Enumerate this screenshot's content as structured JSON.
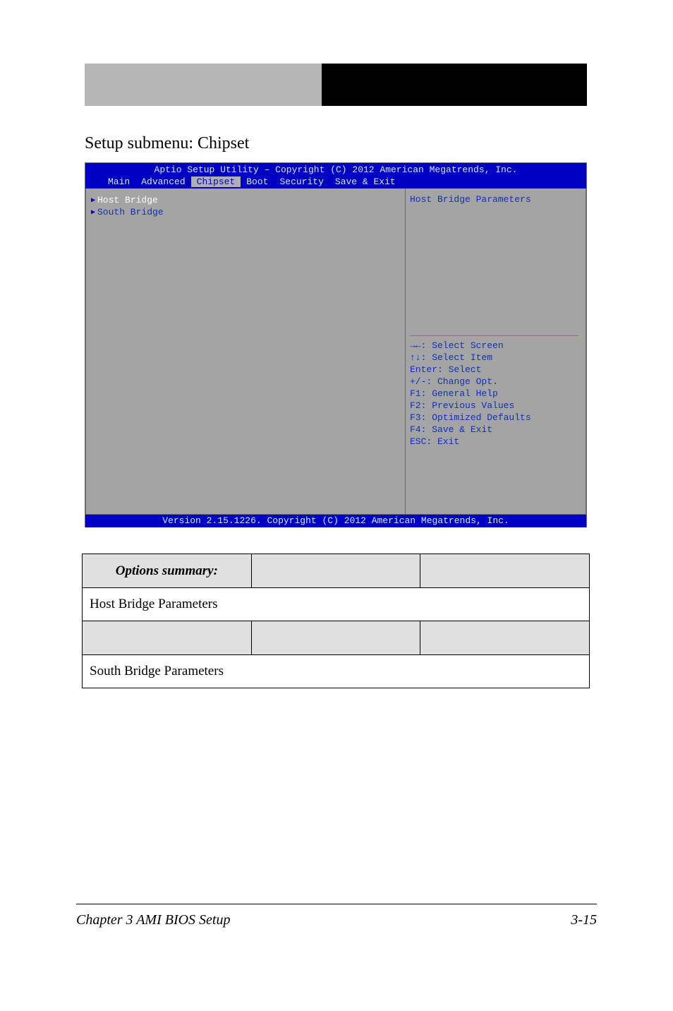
{
  "header": {
    "black_text": ""
  },
  "section_title": "Setup submenu: Chipset",
  "bios": {
    "title": "Aptio Setup Utility – Copyright (C) 2012 American Megatrends, Inc.",
    "menu": {
      "items": [
        "Main",
        "Advanced",
        "Chipset",
        "Boot",
        "Security",
        "Save & Exit"
      ],
      "active_index": 2
    },
    "left_items": [
      {
        "label": "Host Bridge",
        "selected": true
      },
      {
        "label": "South Bridge",
        "selected": false
      }
    ],
    "help_title": "Host Bridge Parameters",
    "keys": [
      "→←: Select Screen",
      "↑↓: Select Item",
      "Enter: Select",
      "+/-: Change Opt.",
      "F1: General Help",
      "F2: Previous Values",
      "F3: Optimized Defaults",
      "F4: Save & Exit",
      "ESC: Exit"
    ],
    "footer": "Version 2.15.1226. Copyright (C) 2012 American Megatrends, Inc."
  },
  "table": {
    "headers": [
      "Options summary:",
      "",
      ""
    ],
    "row1_label": "Host Bridge",
    "row1_desc": "Host Bridge Parameters",
    "row2_label": "South Bridge",
    "row2_desc": "South Bridge Parameters"
  },
  "footer": {
    "left": "Chapter 3 AMI BIOS Setup",
    "right": "3-15"
  }
}
